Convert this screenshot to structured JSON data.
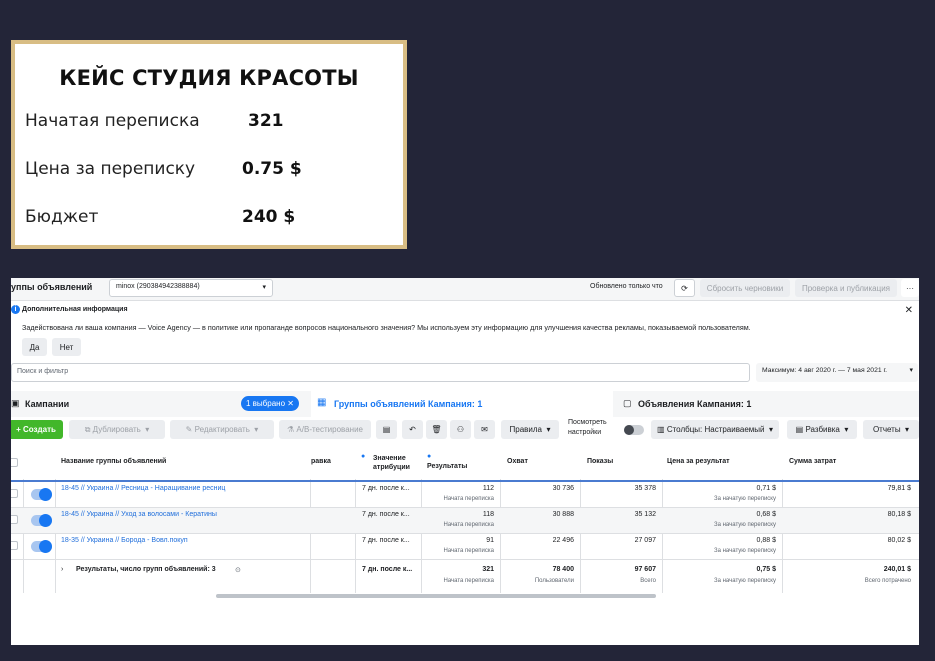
{
  "case": {
    "title": "КЕЙС СТУДИЯ КРАСОТЫ",
    "metrics": [
      {
        "label": "Начатая переписка",
        "value": "321"
      },
      {
        "label": "Цена за переписку",
        "value": "0.75 $"
      },
      {
        "label": "Бюджет",
        "value": "240 $"
      }
    ]
  },
  "topbar": {
    "title": "уппы объявлений",
    "account": "minox (290384942388884)",
    "updated": "Обновлено только что",
    "discard": "Сбросить черновики",
    "review": "Проверка и публикация",
    "more": "···"
  },
  "notice": {
    "title": "Дополнительная информация",
    "text": "Задействована ли ваша компания — Voice Agency — в политике или пропаганде вопросов национального значения? Мы используем эту информацию для улучшения качества рекламы, показываемой пользователям.",
    "yes": "Да",
    "no": "Нет"
  },
  "search": {
    "placeholder": "Поиск и фильтр",
    "date_range": "Максимум: 4 авг 2020 г. — 7 мая 2021 г."
  },
  "tabs": {
    "campaigns": "Кампании",
    "selected": "1 выбрано",
    "adsets": "Группы объявлений Кампания: 1",
    "ads": "Объявления Кампания: 1"
  },
  "toolbar": {
    "create": "Создать",
    "duplicate": "Дублировать",
    "edit": "Редактировать",
    "ab": "A/B-тестирование",
    "rules": "Правила",
    "view_settings_1": "Посмотреть",
    "view_settings_2": "настройки",
    "columns": "Столбцы: Настраиваемый",
    "breakdown": "Разбивка",
    "reports": "Отчеты"
  },
  "table": {
    "headers": {
      "name": "Название группы объявлений",
      "rule": "равка",
      "attribution_1": "Значение",
      "attribution_2": "атрибуции",
      "results": "Результаты",
      "reach": "Охват",
      "impressions": "Показы",
      "cost": "Цена за результат",
      "spent": "Сумма затрат"
    },
    "rows": [
      {
        "name": "18-45 // Украина // Ресница - Наращивание ресниц",
        "attribution": "7 дн. после к...",
        "results": "112",
        "results_sub": "Начата переписка",
        "reach": "30 736",
        "impressions": "35 378",
        "cost": "0,71 $",
        "cost_sub": "За начатую переписку",
        "spent": "79,81 $"
      },
      {
        "name": "18-45 // Украина // Уход за волосами - Кератины",
        "attribution": "7 дн. после к...",
        "results": "118",
        "results_sub": "Начата переписка",
        "reach": "30 888",
        "impressions": "35 132",
        "cost": "0,68 $",
        "cost_sub": "За начатую переписку",
        "spent": "80,18 $"
      },
      {
        "name": "18-35 // Украина // Борода - Вовл.покуп",
        "attribution": "7 дн. после к...",
        "results": "91",
        "results_sub": "Начата переписка",
        "reach": "22 496",
        "impressions": "27 097",
        "cost": "0,88 $",
        "cost_sub": "За начатую переписку",
        "spent": "80,02 $"
      }
    ],
    "totals": {
      "label": "Результаты, число групп объявлений: 3",
      "attribution": "7 дн. после к...",
      "results": "321",
      "results_sub": "Начата переписка",
      "reach": "78 400",
      "reach_sub": "Пользователи",
      "impressions": "97 607",
      "impressions_sub": "Всего",
      "cost": "0,75 $",
      "cost_sub": "За начатую переписку",
      "spent": "240,01 $",
      "spent_sub": "Всего потрачено"
    }
  },
  "colors": {
    "accent": "#1877f2",
    "create": "#42b72a",
    "card_border": "#d8bd84",
    "background": "#232538"
  }
}
